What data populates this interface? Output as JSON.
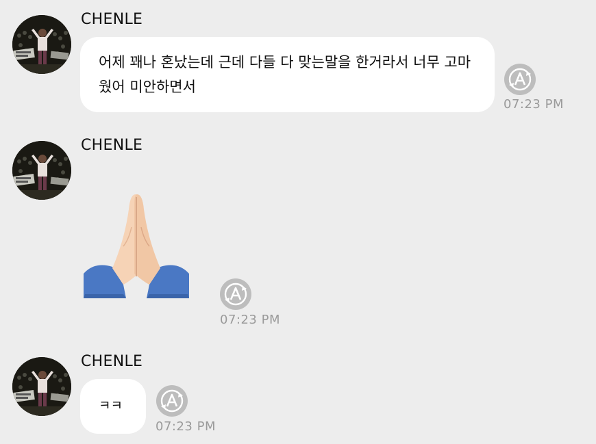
{
  "messages": [
    {
      "sender": "CHENLE",
      "type": "text",
      "text": "어제 꽤나 혼났는데 근데 다들 다 맞는말을 한거라서 너무 고마웠어 미안하면서",
      "time": "07:23 PM",
      "status_icon": "auto-translate-a-icon"
    },
    {
      "sender": "CHENLE",
      "type": "emoji",
      "emoji": "folded-hands-emoji",
      "time": "07:23 PM",
      "status_icon": "auto-translate-a-icon"
    },
    {
      "sender": "CHENLE",
      "type": "text",
      "text": "ㅋㅋ",
      "time": "07:23 PM",
      "status_icon": "auto-translate-a-icon"
    }
  ],
  "colors": {
    "background": "#ededed",
    "bubble": "#ffffff",
    "timestamp": "#9a9a9a",
    "status_icon": "#bdbdbd",
    "sender_name": "#111111"
  }
}
